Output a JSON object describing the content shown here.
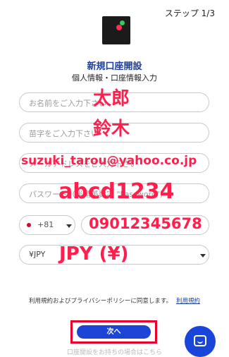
{
  "header": {
    "step_label": "ステップ 1/3",
    "title": "新規口座開設",
    "subtitle": "個人情報・口座情報入力"
  },
  "form": {
    "first_name": {
      "placeholder": "お名前をご入力下さい",
      "overlay": "太郎"
    },
    "last_name": {
      "placeholder": "苗字をご入力下さい",
      "overlay": "鈴木"
    },
    "email": {
      "placeholder": "メールアドレスをご入力下さい",
      "overlay": "suzuki_tarou@yahoo.co.jp"
    },
    "password": {
      "placeholder": "パスワード（半角英数字 \"Password\"）",
      "overlay": "abcd1234"
    },
    "phone_code": {
      "value": "+81"
    },
    "phone": {
      "overlay": "09012345678"
    },
    "currency": {
      "value": "¥JPY",
      "overlay": "JPY (¥)"
    }
  },
  "footer": {
    "terms_text": "利用規約およびプライバシーポリシーに同意します。",
    "terms_link": "利用規約",
    "next_label": "次へ",
    "bottom_text": "口座開設をお持ちの場合はこちら"
  },
  "colors": {
    "accent": "#1c44d6",
    "title": "#1d3f9e",
    "overlay": "#ff1e4c",
    "highlight_border": "#e8002a"
  }
}
